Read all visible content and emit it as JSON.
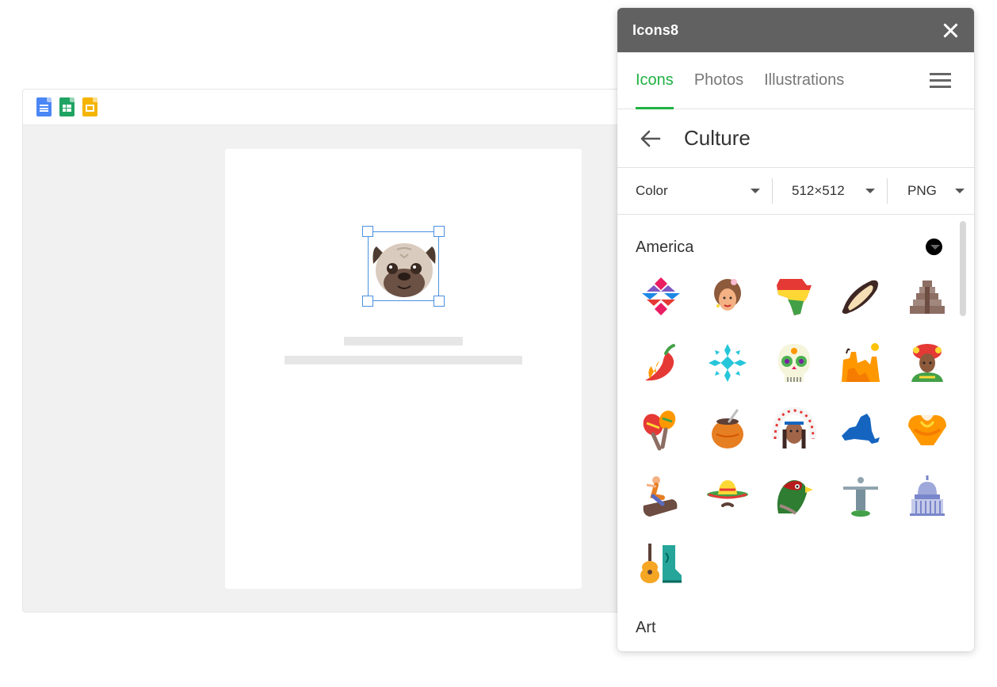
{
  "editor": {
    "toolbar_apps": [
      "docs-icon",
      "sheets-icon",
      "slides-icon"
    ]
  },
  "panel": {
    "title": "Icons8",
    "tabs": [
      {
        "label": "Icons",
        "active": true
      },
      {
        "label": "Photos",
        "active": false
      },
      {
        "label": "Illustrations",
        "active": false
      }
    ],
    "category": "Culture",
    "filters": {
      "color": "Color",
      "size": "512×512",
      "format": "PNG"
    },
    "sections": [
      {
        "title": "America",
        "swatch_color": "#000000",
        "icons": [
          "native-pattern-icon",
          "flamenco-woman-icon",
          "africa-map-icon",
          "brazil-nut-icon",
          "mayan-pyramid-icon",
          "chili-pepper-icon",
          "snowflake-pattern-icon",
          "sugar-skull-icon",
          "desert-cactus-icon",
          "carnival-dancer-icon",
          "maracas-icon",
          "mate-gourd-icon",
          "native-chief-icon",
          "new-york-map-icon",
          "poncho-icon",
          "rodeo-icon",
          "sombrero-icon",
          "pheasant-icon",
          "christ-redeemer-icon",
          "capitol-icon",
          "guitar-boot-icon"
        ]
      },
      {
        "title": "Art"
      }
    ],
    "accent_color": "#1fb141",
    "header_color": "#616161"
  }
}
